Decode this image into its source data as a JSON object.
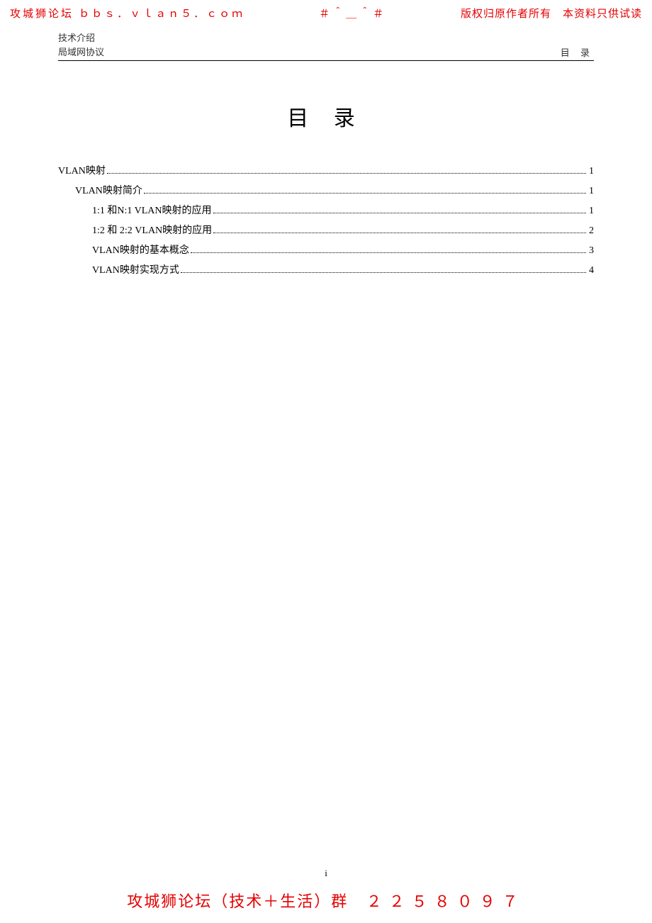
{
  "watermark": {
    "top_left": "攻城狮论坛 ｂｂｓ．ｖｌａｎ５．ｃｏｍ",
    "top_center": "＃＾＿＾＃",
    "top_right": "版权归原作者所有　本资料只供试读",
    "bottom_text": "攻城狮论坛（技术＋生活）群",
    "bottom_num": "２２５８０９７"
  },
  "header": {
    "line1": "技术介绍",
    "line2": "局域网协议",
    "right": "目 录"
  },
  "title": "目 录",
  "toc": [
    {
      "level": 0,
      "label": "VLAN映射",
      "page": "1"
    },
    {
      "level": 1,
      "label": "VLAN映射简介",
      "page": "1"
    },
    {
      "level": 2,
      "label": "1:1 和N:1 VLAN映射的应用",
      "page": "1"
    },
    {
      "level": 2,
      "label": "1:2 和 2:2 VLAN映射的应用",
      "page": "2"
    },
    {
      "level": 2,
      "label": "VLAN映射的基本概念",
      "page": "3"
    },
    {
      "level": 2,
      "label": "VLAN映射实现方式",
      "page": "4"
    }
  ],
  "page_number": "i"
}
